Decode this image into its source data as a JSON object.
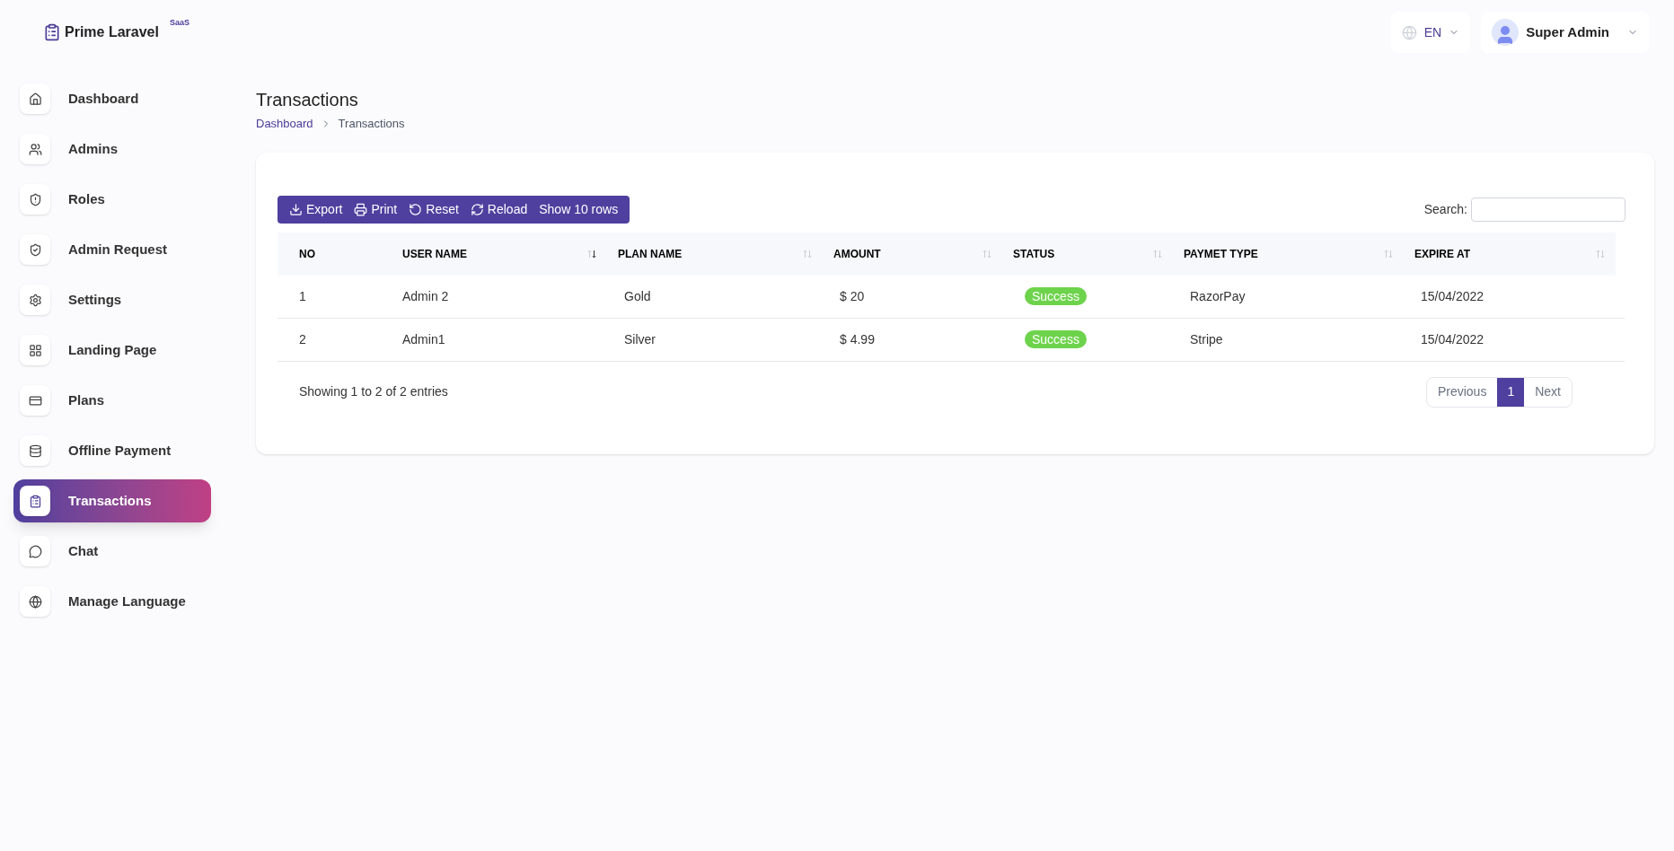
{
  "brand": {
    "name": "Prime Laravel",
    "badge": "SaaS"
  },
  "header": {
    "language": "EN",
    "user": "Super Admin"
  },
  "sidebar": {
    "items": [
      {
        "label": "Dashboard",
        "selected": false
      },
      {
        "label": "Admins",
        "selected": false
      },
      {
        "label": "Roles",
        "selected": false
      },
      {
        "label": "Admin Request",
        "selected": false
      },
      {
        "label": "Settings",
        "selected": false
      },
      {
        "label": "Landing Page",
        "selected": false
      },
      {
        "label": "Plans",
        "selected": false
      },
      {
        "label": "Offline Payment",
        "selected": false
      },
      {
        "label": "Transactions",
        "selected": true
      },
      {
        "label": "Chat",
        "selected": false
      },
      {
        "label": "Manage Language",
        "selected": false
      }
    ]
  },
  "page": {
    "title": "Transactions",
    "breadcrumb": [
      {
        "label": "Dashboard",
        "kind": "link"
      },
      {
        "label": "Transactions",
        "kind": "current"
      }
    ]
  },
  "toolbar": {
    "buttons": [
      {
        "label": "Export",
        "kind": "export"
      },
      {
        "label": "Print",
        "kind": "print"
      },
      {
        "label": "Reset",
        "kind": "reset"
      },
      {
        "label": "Reload",
        "kind": "reload"
      },
      {
        "label": "Show 10 rows",
        "kind": "plain"
      }
    ]
  },
  "search": {
    "label": "Search:"
  },
  "table": {
    "columns": [
      {
        "label": "NO",
        "sortable": false
      },
      {
        "label": "USER NAME",
        "sortable": true,
        "sorted": true
      },
      {
        "label": "PLAN NAME",
        "sortable": true,
        "sorted": false
      },
      {
        "label": "AMOUNT",
        "sortable": true,
        "sorted": false
      },
      {
        "label": "STATUS",
        "sortable": true,
        "sorted": false
      },
      {
        "label": "PAYMET TYPE",
        "sortable": true,
        "sorted": false
      },
      {
        "label": "EXPIRE AT",
        "sortable": true,
        "sorted": false
      }
    ],
    "rows": [
      {
        "no": "1",
        "user": "Admin 2",
        "plan": "Gold",
        "amount": "$ 20",
        "status": "Success",
        "payment": "RazorPay",
        "expire": "15/04/2022"
      },
      {
        "no": "2",
        "user": "Admin1",
        "plan": "Silver",
        "amount": "$ 4.99",
        "status": "Success",
        "payment": "Stripe",
        "expire": "15/04/2022"
      }
    ]
  },
  "footer": {
    "info": "Showing 1 to 2 of 2 entries"
  },
  "pagination": {
    "previous": "Previous",
    "next": "Next",
    "pages": [
      {
        "label": "1",
        "selected": true
      }
    ]
  }
}
